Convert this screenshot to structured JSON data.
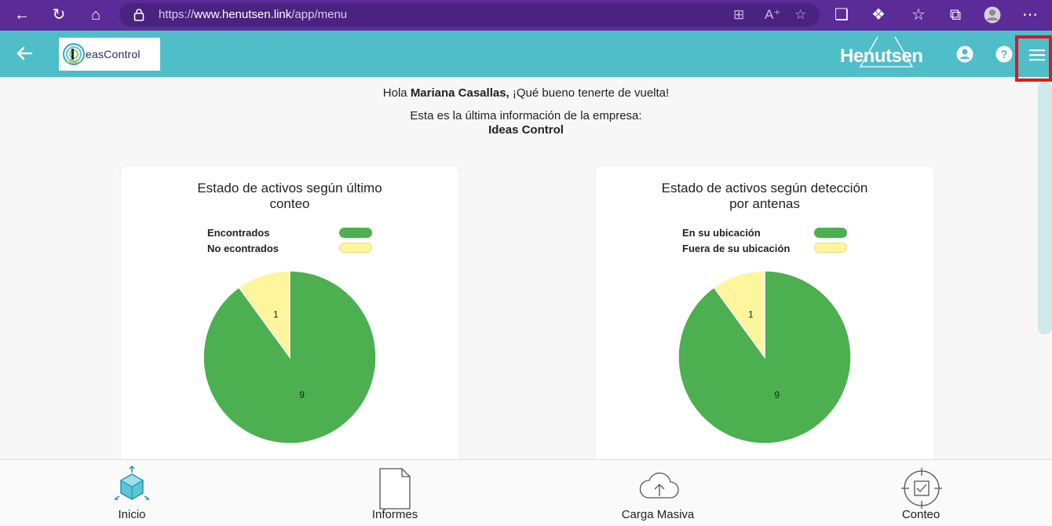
{
  "browser": {
    "url_prefix": "https://",
    "url_domain": "www.henutsen.link",
    "url_path": "/app/menu"
  },
  "header": {
    "logo_text": "easControl",
    "brand": "Henutsen"
  },
  "main": {
    "greeting_prefix": "Hola ",
    "user_name": "Mariana Casallas,",
    "greeting_suffix": " ¡Qué bueno tenerte de vuelta!",
    "info_text": "Esta es la última información de la empresa:",
    "company_name": "Ideas Control"
  },
  "charts": [
    {
      "title_line1": "Estado de activos según último",
      "title_line2": "conteo",
      "legend": [
        {
          "label": "Encontrados",
          "color": "#4caf50"
        },
        {
          "label": "No econtrados",
          "color": "#fff59d"
        }
      ]
    },
    {
      "title_line1": "Estado de activos según detección",
      "title_line2": "por antenas",
      "legend": [
        {
          "label": "En su ubicación",
          "color": "#4caf50"
        },
        {
          "label": "Fuera de su ubicación",
          "color": "#fff59d"
        }
      ]
    }
  ],
  "chart_data": [
    {
      "type": "pie",
      "title": "Estado de activos según último conteo",
      "categories": [
        "Encontrados",
        "No econtrados"
      ],
      "values": [
        9,
        1
      ],
      "colors": [
        "#4caf50",
        "#fff59d"
      ]
    },
    {
      "type": "pie",
      "title": "Estado de activos según detección por antenas",
      "categories": [
        "En su ubicación",
        "Fuera de su ubicación"
      ],
      "values": [
        9,
        1
      ],
      "colors": [
        "#4caf50",
        "#fff59d"
      ]
    }
  ],
  "bottom_nav": {
    "items": [
      {
        "label": "Inicio",
        "icon": "cube-icon"
      },
      {
        "label": "Informes",
        "icon": "document-icon"
      },
      {
        "label": "Carga Masiva",
        "icon": "cloud-upload-icon"
      },
      {
        "label": "Conteo",
        "icon": "target-check-icon"
      }
    ]
  },
  "colors": {
    "browser": "#5b2b97",
    "header": "#4fbec9",
    "highlight": "#e8141c"
  }
}
